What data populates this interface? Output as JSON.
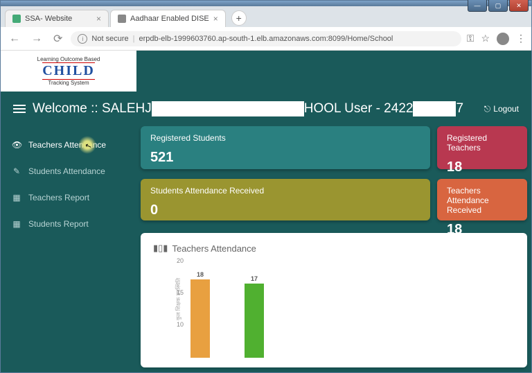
{
  "browser": {
    "tabs": [
      {
        "title": "SSA- Website"
      },
      {
        "title": "Aadhaar Enabled DISE"
      }
    ],
    "not_secure": "Not secure",
    "url": "erpdb-elb-1999603760.ap-south-1.elb.amazonaws.com:8099/Home/School"
  },
  "logo": {
    "top": "Learning Outcome Based",
    "main": "CHILD",
    "sub": "Tracking System"
  },
  "header": {
    "welcome_prefix": "Welcome :: SALEHJ",
    "welcome_mid": "HOOL User - 2422",
    "welcome_suffix": "7",
    "logout": "Logout"
  },
  "sidebar": {
    "items": [
      {
        "label": "Teachers Attendance"
      },
      {
        "label": "Students Attendance"
      },
      {
        "label": "Teachers Report"
      },
      {
        "label": "Students Report"
      }
    ]
  },
  "cards": {
    "reg_students": {
      "title": "Registered Students",
      "value": "521"
    },
    "reg_teachers": {
      "title": "Registered Teachers",
      "value": "18"
    },
    "stu_att": {
      "title": "Students Attendance Received",
      "value": "0"
    },
    "tea_att": {
      "title": "Teachers Attendance Received",
      "value": "18"
    }
  },
  "chart_data": {
    "type": "bar",
    "title": "Teachers Attendance",
    "ylabel": "कुल शिक्षक उपस्थिति",
    "ylim": [
      0,
      20
    ],
    "yticks": [
      "20",
      "15",
      "10"
    ],
    "categories": [
      "",
      ""
    ],
    "series": [
      {
        "name": "bar1",
        "value": 18,
        "label": "18",
        "color": "#e8a040"
      },
      {
        "name": "bar2",
        "value": 17,
        "label": "17",
        "color": "#50b030"
      }
    ]
  }
}
